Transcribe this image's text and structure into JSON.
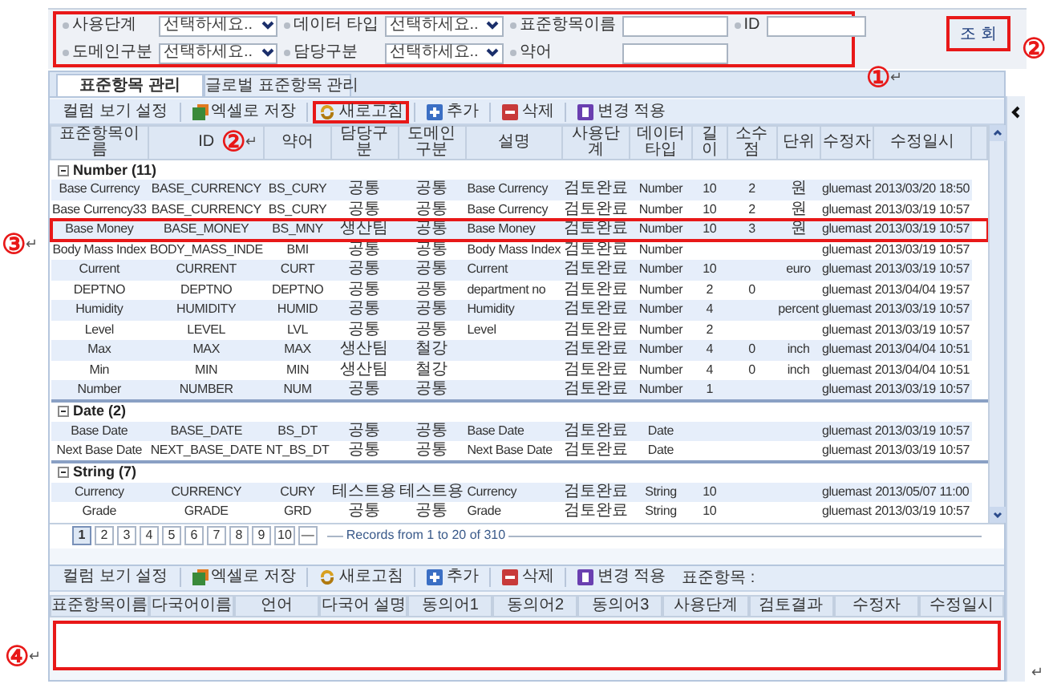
{
  "filters": [
    {
      "label": "사용단계",
      "kind": "select",
      "value": "선택하세요.."
    },
    {
      "label": "데이터 타입",
      "kind": "select",
      "value": "선택하세요.."
    },
    {
      "label": "표준항목이름",
      "kind": "text"
    },
    {
      "label": "ID",
      "kind": "text"
    },
    {
      "label": "도메인구분",
      "kind": "select",
      "value": "선택하세요.."
    },
    {
      "label": "담당구분",
      "kind": "select",
      "value": "선택하세요.."
    },
    {
      "label": "약어",
      "kind": "text"
    }
  ],
  "search_button": "조 회",
  "tabs": [
    {
      "label": "표준항목 관리",
      "selected": true
    },
    {
      "label": "글로벌 표준항목 관리",
      "selected": false
    }
  ],
  "toolbar": {
    "items": [
      {
        "label": "컬럼 보기 설정",
        "kind": "plain",
        "annotated": false
      },
      {
        "label": "엑셀로 저장",
        "kind": "excel",
        "annotated": false
      },
      {
        "label": "새로고침",
        "kind": "refresh",
        "annotated": true
      },
      {
        "label": "추가",
        "kind": "add",
        "annotated": false
      },
      {
        "label": "삭제",
        "kind": "delete",
        "annotated": false
      },
      {
        "label": "변경 적용",
        "kind": "apply",
        "annotated": false
      }
    ]
  },
  "table": {
    "columns": [
      "표준항목이름",
      "ID",
      "약어",
      "담당구분",
      "도메인구분",
      "설명",
      "사용단계",
      "데이터 타입",
      "길이",
      "소수점",
      "단위",
      "수정자",
      "수정일시"
    ],
    "groups": [
      {
        "label": "Number (11)",
        "expanded": true,
        "rows": [
          {
            "annotated": false,
            "cells": [
              "Base Currency",
              "BASE_CURRENCY",
              "BS_CURY",
              "공통",
              "공통",
              "Base Currency",
              "검토완료",
              "Number",
              "10",
              "2",
              "원",
              "gluemast",
              "2013/03/20 18:50"
            ]
          },
          {
            "annotated": false,
            "cells": [
              "Base Currency33",
              "BASE_CURRENCY",
              "BS_CURY",
              "공통",
              "공통",
              "Base Currency",
              "검토완료",
              "Number",
              "10",
              "2",
              "원",
              "gluemast",
              "2013/03/19 10:57"
            ]
          },
          {
            "annotated": true,
            "cells": [
              "Base Money",
              "BASE_MONEY",
              "BS_MNY",
              "생산팀",
              "공통",
              "Base Money",
              "검토완료",
              "Number",
              "10",
              "3",
              "원",
              "gluemast",
              "2013/03/19 10:57"
            ]
          },
          {
            "annotated": false,
            "cells": [
              "Body Mass Index",
              "BODY_MASS_INDE",
              "BMI",
              "공통",
              "공통",
              "Body Mass Index",
              "검토완료",
              "Number",
              null,
              null,
              null,
              "gluemast",
              "2013/03/19 10:57"
            ]
          },
          {
            "annotated": false,
            "cells": [
              "Current",
              "CURRENT",
              "CURT",
              "공통",
              "공통",
              "Current",
              "검토완료",
              "Number",
              "10",
              null,
              "euro",
              "gluemast",
              "2013/03/19 10:57"
            ]
          },
          {
            "annotated": false,
            "cells": [
              "DEPTNO",
              "DEPTNO",
              "DEPTNO",
              "공통",
              "공통",
              "department no",
              "검토완료",
              "Number",
              "2",
              "0",
              null,
              "gluemast",
              "2013/04/04 19:57"
            ]
          },
          {
            "annotated": false,
            "cells": [
              "Humidity",
              "HUMIDITY",
              "HUMID",
              "공통",
              "공통",
              "Humidity",
              "검토완료",
              "Number",
              "4",
              null,
              "percent",
              "gluemast",
              "2013/03/19 10:57"
            ]
          },
          {
            "annotated": false,
            "cells": [
              "Level",
              "LEVEL",
              "LVL",
              "공통",
              "공통",
              "Level",
              "검토완료",
              "Number",
              "2",
              null,
              null,
              "gluemast",
              "2013/03/19 10:57"
            ]
          },
          {
            "annotated": false,
            "cells": [
              "Max",
              "MAX",
              "MAX",
              "생산팀",
              "철강",
              null,
              "검토완료",
              "Number",
              "4",
              "0",
              "inch",
              "gluemast",
              "2013/04/04 10:51"
            ]
          },
          {
            "annotated": false,
            "cells": [
              "Min",
              "MIN",
              "MIN",
              "생산팀",
              "철강",
              null,
              "검토완료",
              "Number",
              "4",
              "0",
              "inch",
              "gluemast",
              "2013/04/04 10:51"
            ]
          },
          {
            "annotated": false,
            "cells": [
              "Number",
              "NUMBER",
              "NUM",
              "공통",
              "공통",
              null,
              "검토완료",
              "Number",
              "1",
              null,
              null,
              "gluemast",
              "2013/03/19 10:57"
            ]
          }
        ]
      },
      {
        "label": "Date (2)",
        "expanded": true,
        "rows": [
          {
            "annotated": false,
            "cells": [
              "Base Date",
              "BASE_DATE",
              "BS_DT",
              "공통",
              "공통",
              "Base Date",
              "검토완료",
              "Date",
              null,
              null,
              null,
              "gluemast",
              "2013/03/19 10:57"
            ]
          },
          {
            "annotated": false,
            "cells": [
              "Next Base Date",
              "NEXT_BASE_DATE",
              "NT_BS_DT",
              "공통",
              "공통",
              "Next Base Date",
              "검토완료",
              "Date",
              null,
              null,
              null,
              "gluemast",
              "2013/03/19 10:57"
            ]
          }
        ]
      },
      {
        "label": "String (7)",
        "expanded": true,
        "rows": [
          {
            "annotated": false,
            "cells": [
              "Currency",
              "CURRENCY",
              "CURY",
              "테스트용",
              "테스트용",
              "Currency",
              "검토완료",
              "String",
              "10",
              null,
              null,
              "gluemast",
              "2013/05/07 11:00"
            ]
          },
          {
            "annotated": false,
            "cells": [
              "Grade",
              "GRADE",
              "GRD",
              "공통",
              "공통",
              "Grade",
              "검토완료",
              "String",
              "10",
              null,
              null,
              "gluemast",
              "2013/03/19 10:57"
            ]
          }
        ]
      }
    ]
  },
  "pagination": {
    "pages": [
      {
        "label": "1",
        "selected": true
      },
      {
        "label": "2",
        "selected": false
      },
      {
        "label": "3",
        "selected": false
      },
      {
        "label": "4",
        "selected": false
      },
      {
        "label": "5",
        "selected": false
      },
      {
        "label": "6",
        "selected": false
      },
      {
        "label": "7",
        "selected": false
      },
      {
        "label": "8",
        "selected": false
      },
      {
        "label": "9",
        "selected": false
      },
      {
        "label": "10",
        "selected": false
      }
    ],
    "next": "—",
    "records": "Records from 1 to 20 of 310"
  },
  "detail": {
    "toolbar": {
      "items": [
        {
          "label": "컬럼 보기 설정",
          "kind": "plain"
        },
        {
          "label": "엑셀로 저장",
          "kind": "excel"
        },
        {
          "label": "새로고침",
          "kind": "refresh"
        },
        {
          "label": "추가",
          "kind": "add"
        },
        {
          "label": "삭제",
          "kind": "delete"
        },
        {
          "label": "변경 적용",
          "kind": "apply"
        }
      ],
      "caption": "표준항목 :"
    },
    "columns": [
      "표준항목이름",
      "다국어이름",
      "언어",
      "다국어 설명",
      "동의어1",
      "동의어2",
      "동의어3",
      "사용단계",
      "검토결과",
      "수정자",
      "수정일시"
    ]
  },
  "annotations": [
    {
      "kind": "filters",
      "number": "①",
      "mark": "↵"
    },
    {
      "kind": "search",
      "number": "②"
    },
    {
      "kind": "refresh",
      "number": "②",
      "mark": "↵"
    },
    {
      "kind": "row",
      "number": "③",
      "mark": "↵"
    },
    {
      "kind": "detail",
      "number": "④",
      "mark": "↵"
    },
    {
      "kind": "end",
      "mark": "↵"
    }
  ]
}
